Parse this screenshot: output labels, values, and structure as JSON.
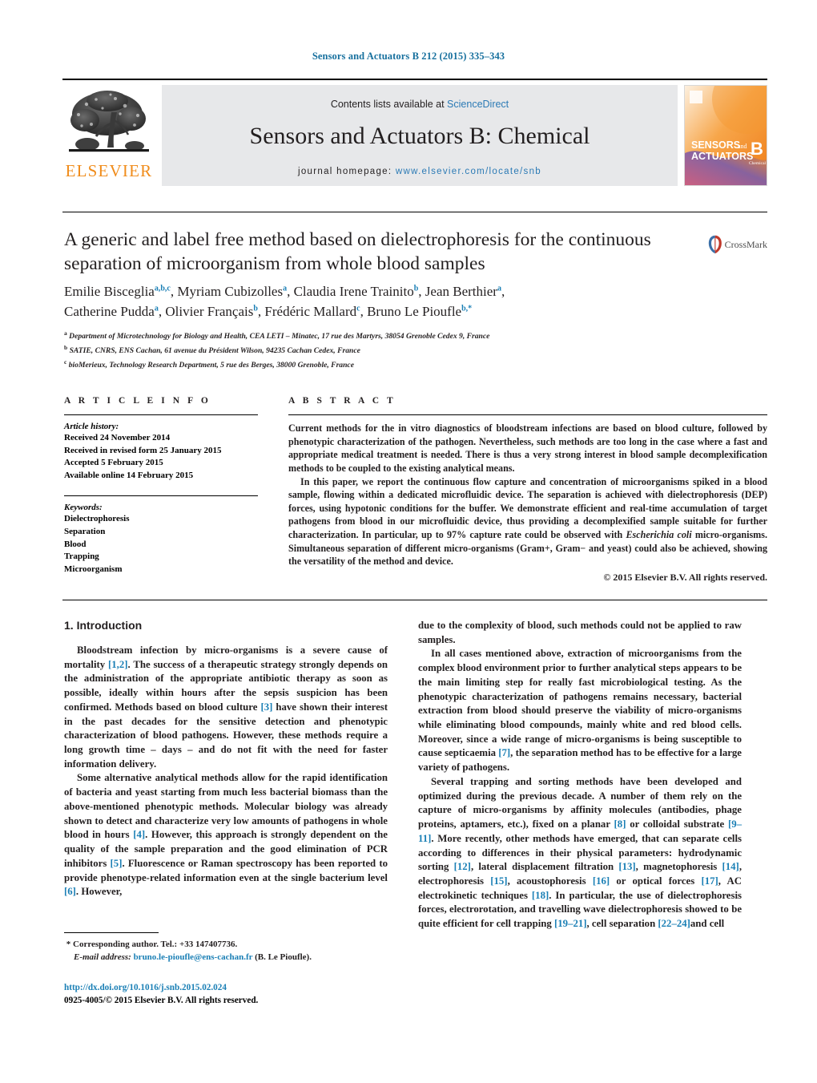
{
  "journal_ref": "Sensors and Actuators B 212 (2015) 335–343",
  "masthead": {
    "contents_prefix": "Contents lists available at ",
    "sciencedirect": "ScienceDirect",
    "journal_title": "Sensors and Actuators B: Chemical",
    "homepage_label": "journal homepage:",
    "homepage_url": "www.elsevier.com/locate/snb",
    "publisher_name": "ELSEVIER",
    "cover_line1": "SENSORS",
    "cover_and": "and",
    "cover_line2": "ACTUATORS",
    "cover_letter": "B",
    "cover_sub": "Chemical"
  },
  "crossmark": {
    "label": "CrossMark"
  },
  "title": "A generic and label free method based on dielectrophoresis for the continuous separation of microorganism from whole blood samples",
  "authors": [
    {
      "name": "Emilie Bisceglia",
      "marks": "a,b,c",
      "sep": ", "
    },
    {
      "name": "Myriam Cubizolles",
      "marks": "a",
      "sep": ", "
    },
    {
      "name": "Claudia Irene Trainito",
      "marks": "b",
      "sep": ", "
    },
    {
      "name": "Jean Berthier",
      "marks": "a",
      "sep": ", "
    },
    {
      "name": "Catherine Pudda",
      "marks": "a",
      "sep": ", "
    },
    {
      "name": "Olivier Français",
      "marks": "b",
      "sep": ", "
    },
    {
      "name": "Frédéric Mallard",
      "marks": "c",
      "sep": ", "
    },
    {
      "name": "Bruno Le Pioufle",
      "marks": "b,",
      "sep": ""
    }
  ],
  "affiliations": [
    {
      "mark": "a",
      "text": "Department of Microtechnology for Biology and Health, CEA LETI – Minatec, 17 rue des Martyrs, 38054 Grenoble Cedex 9, France"
    },
    {
      "mark": "b",
      "text": "SATIE, CNRS, ENS Cachan, 61 avenue du Président Wilson, 94235 Cachan Cedex, France"
    },
    {
      "mark": "c",
      "text": "bioMerieux, Technology Research Department, 5 rue des Berges, 38000 Grenoble, France"
    }
  ],
  "article_info": {
    "heading": "A R T I C L E   I N F O",
    "history_label": "Article history:",
    "history": [
      "Received 24 November 2014",
      "Received in revised form 25 January 2015",
      "Accepted 5 February 2015",
      "Available online 14 February 2015"
    ],
    "keywords_label": "Keywords:",
    "keywords": [
      "Dielectrophoresis",
      "Separation",
      "Blood",
      "Trapping",
      "Microorganism"
    ]
  },
  "abstract": {
    "heading": "A B S T R A C T",
    "paragraph1": "Current methods for the in vitro diagnostics of bloodstream infections are based on blood culture, followed by phenotypic characterization of the pathogen. Nevertheless, such methods are too long in the case where a fast and appropriate medical treatment is needed. There is thus a very strong interest in blood sample decomplexification methods to be coupled to the existing analytical means.",
    "paragraph2_a": "In this paper, we report the continuous flow capture and concentration of microorganisms spiked in a blood sample, flowing within a dedicated microfluidic device. The separation is achieved with dielectrophoresis (DEP) forces, using hypotonic conditions for the buffer. We demonstrate efficient and real-time accumulation of target pathogens from blood in our microfluidic device, thus providing a decomplexified sample suitable for further characterization. In particular, up to 97% capture rate could be observed with ",
    "paragraph2_italic": "Escherichia coli",
    "paragraph2_b": " micro-organisms. Simultaneous separation of different micro-organisms (Gram+, Gram− and yeast) could also be achieved, showing the versatility of the method and device.",
    "copyright": "© 2015 Elsevier B.V. All rights reserved."
  },
  "introduction": {
    "heading": "1.  Introduction",
    "left_p1_a": "Bloodstream infection by micro-organisms is a severe cause of mortality ",
    "left_p1_ref1": "[1,2]",
    "left_p1_b": ". The success of a therapeutic strategy strongly depends on the administration of the appropriate antibiotic therapy as soon as possible, ideally within hours after the sepsis suspicion has been confirmed. Methods based on blood culture ",
    "left_p1_ref2": "[3]",
    "left_p1_c": " have shown their interest in the past decades for the sensitive detection and phenotypic characterization of blood pathogens. However, these methods require a long growth time – days – and do not fit with the need for faster information delivery.",
    "left_p2_a": "Some alternative analytical methods allow for the rapid identification of bacteria and yeast starting from much less bacterial biomass than the above-mentioned phenotypic methods. Molecular biology was already shown to detect and characterize very low amounts of pathogens in whole blood in hours ",
    "left_p2_ref1": "[4]",
    "left_p2_b": ". However, this approach is strongly dependent on the quality of the sample preparation and the good elimination of PCR inhibitors ",
    "left_p2_ref2": "[5]",
    "left_p2_c": ". Fluorescence or Raman spectroscopy has been reported to provide phenotype-related information even at the single bacterium level ",
    "left_p2_ref3": "[6]",
    "left_p2_d": ". However,",
    "right_p1": "due to the complexity of blood, such methods could not be applied to raw samples.",
    "right_p2_a": "In all cases mentioned above, extraction of microorganisms from the complex blood environment prior to further analytical steps appears to be the main limiting step for really fast microbiological testing. As the phenotypic characterization of pathogens remains necessary, bacterial extraction from blood should preserve the viability of micro-organisms while eliminating blood compounds, mainly white and red blood cells. Moreover, since a wide range of micro-organisms is being susceptible to cause septicaemia ",
    "right_p2_ref1": "[7]",
    "right_p2_b": ", the separation method has to be effective for a large variety of pathogens.",
    "right_p3_a": "Several trapping and sorting methods have been developed and optimized during the previous decade. A number of them rely on the capture of micro-organisms by affinity molecules (antibodies, phage proteins, aptamers, etc.), fixed on a planar ",
    "right_p3_ref1": "[8]",
    "right_p3_b": " or colloidal substrate ",
    "right_p3_ref2": "[9–11]",
    "right_p3_c": ". More recently, other methods have emerged, that can separate cells according to differences in their physical parameters: hydrodynamic sorting ",
    "right_p3_ref3": "[12]",
    "right_p3_d": ", lateral displacement filtration ",
    "right_p3_ref4": "[13]",
    "right_p3_e": ", magnetophoresis ",
    "right_p3_ref5": "[14]",
    "right_p3_f": ", electrophoresis ",
    "right_p3_ref6": "[15]",
    "right_p3_g": ", acoustophoresis ",
    "right_p3_ref7": "[16]",
    "right_p3_h": " or optical forces ",
    "right_p3_ref8": "[17]",
    "right_p3_i": ", AC electrokinetic techniques ",
    "right_p3_ref9": "[18]",
    "right_p3_j": ". In particular, the use of dielectrophoresis forces, electrorotation, and travelling wave dielectrophoresis showed to be quite efficient for cell trapping ",
    "right_p3_ref10": "[19–21]",
    "right_p3_k": ", cell separation ",
    "right_p3_ref11": "[22–24]",
    "right_p3_l": "and cell"
  },
  "footnote": {
    "star": "*",
    "corresponding": " Corresponding author. Tel.: +33 147407736.",
    "email_label": "E-mail address:",
    "email": "bruno.le-pioufle@ens-cachan.fr",
    "email_owner": "(B. Le Pioufle)."
  },
  "doi": {
    "url": "http://dx.doi.org/10.1016/j.snb.2015.02.024",
    "issn_line": "0925-4005/© 2015 Elsevier B.V. All rights reserved."
  },
  "colors": {
    "link_blue": "#1a7fb5",
    "sciencedirect_blue": "#2b7ab5",
    "elsevier_orange": "#f08c1b",
    "masthead_gray": "#e7e8ea"
  }
}
